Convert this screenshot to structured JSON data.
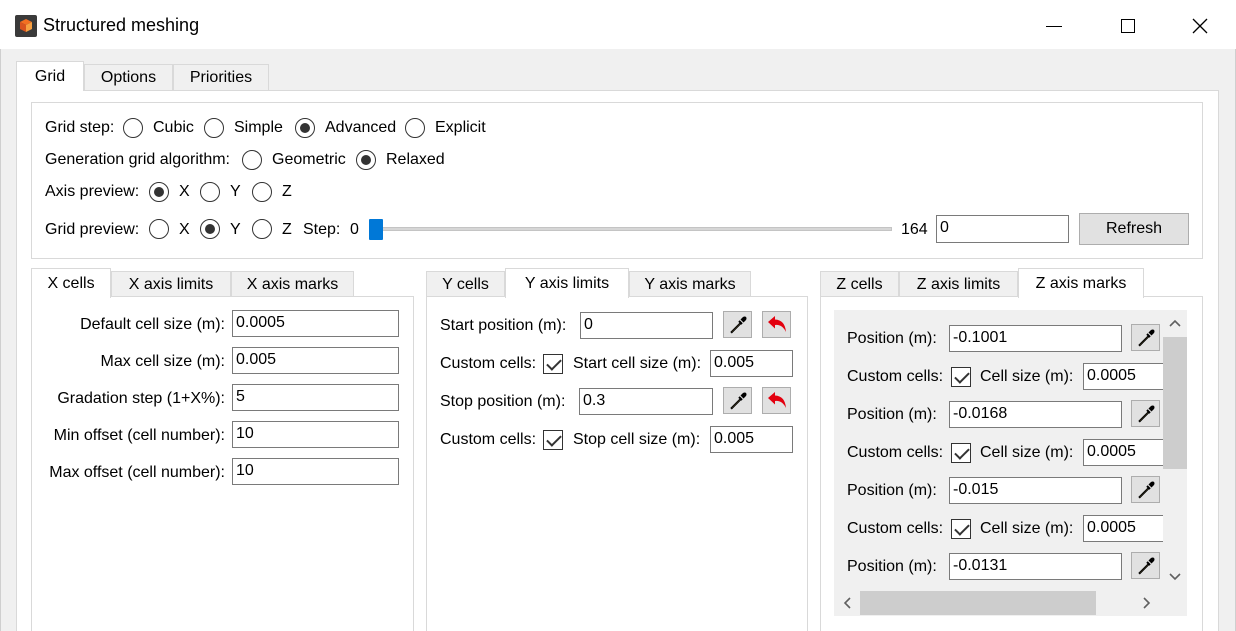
{
  "window": {
    "title": "Structured meshing"
  },
  "tabs": {
    "grid": "Grid",
    "options": "Options",
    "priorities": "Priorities"
  },
  "grid_step": {
    "label": "Grid step:",
    "options": [
      "Cubic",
      "Simple",
      "Advanced",
      "Explicit"
    ],
    "selected": "Advanced"
  },
  "algorithm": {
    "label": "Generation grid algorithm:",
    "options": [
      "Geometric",
      "Relaxed"
    ],
    "selected": "Relaxed"
  },
  "axis_preview": {
    "label": "Axis preview:",
    "options": [
      "X",
      "Y",
      "Z"
    ],
    "selected": "X"
  },
  "grid_preview": {
    "label": "Grid preview:",
    "options": [
      "X",
      "Y",
      "Z"
    ],
    "selected": "Y",
    "step_label": "Step:",
    "slider_min": "0",
    "slider_max": "164",
    "slider_value": 0,
    "step_value": "0",
    "refresh_label": "Refresh"
  },
  "x_panel": {
    "tabs": [
      "X cells",
      "X axis limits",
      "X axis marks"
    ],
    "active_tab": "X cells",
    "fields": [
      {
        "label": "Default cell size (m):",
        "value": "0.0005"
      },
      {
        "label": "Max cell size (m):",
        "value": "0.005"
      },
      {
        "label": "Gradation step (1+X%):",
        "value": "5"
      },
      {
        "label": "Min offset (cell number):",
        "value": "10"
      },
      {
        "label": "Max offset (cell number):",
        "value": "10"
      }
    ]
  },
  "y_panel": {
    "tabs": [
      "Y cells",
      "Y axis limits",
      "Y axis marks"
    ],
    "active_tab": "Y axis limits",
    "start_position_label": "Start position (m):",
    "start_position_value": "0",
    "start_custom_label": "Custom cells:",
    "start_custom_checked": true,
    "start_cell_size_label": "Start cell size (m):",
    "start_cell_size_value": "0.005",
    "stop_position_label": "Stop position (m):",
    "stop_position_value": "0.3",
    "stop_custom_label": "Custom cells:",
    "stop_custom_checked": true,
    "stop_cell_size_label": "Stop cell size (m):",
    "stop_cell_size_value": "0.005"
  },
  "z_panel": {
    "tabs": [
      "Z cells",
      "Z axis limits",
      "Z axis marks"
    ],
    "active_tab": "Z axis marks",
    "position_label": "Position (m):",
    "custom_label": "Custom cells:",
    "cell_size_label": "Cell size (m):",
    "marks": [
      {
        "position": "-0.1001",
        "cell_size": "0.0005",
        "custom": true
      },
      {
        "position": "-0.0168",
        "cell_size": "0.0005",
        "custom": true
      },
      {
        "position": "-0.015",
        "cell_size": "0.0005",
        "custom": true
      },
      {
        "position": "-0.0131"
      }
    ]
  },
  "icons": {
    "picker": "eyedropper-icon",
    "reset": "undo-arrow-icon",
    "reset_color": "#e3000f"
  },
  "colors": {
    "accent": "#0078d7"
  }
}
